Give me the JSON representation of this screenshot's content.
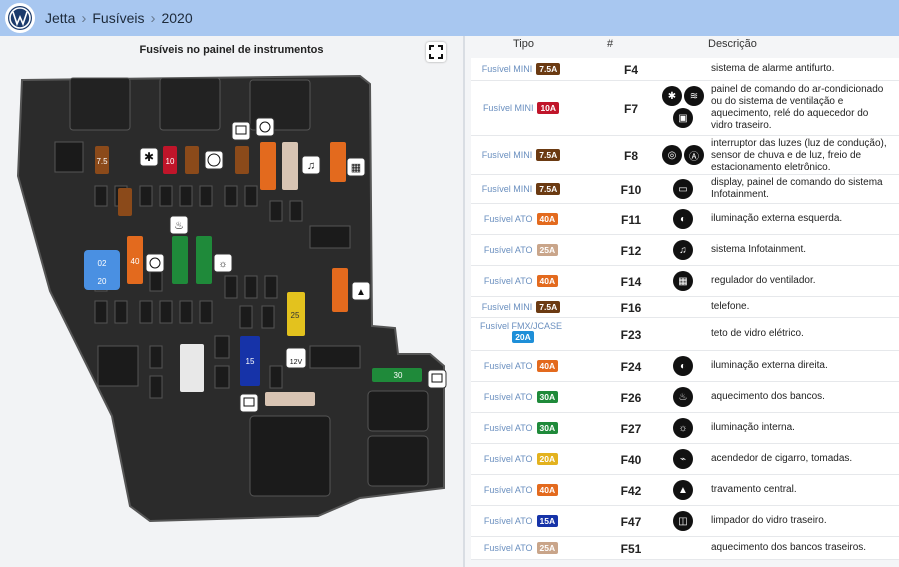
{
  "header": {
    "breadcrumbs": [
      "Jetta",
      "Fusíveis",
      "2020"
    ]
  },
  "left_panel": {
    "title": "Fusíveis no painel de instrumentos"
  },
  "table": {
    "columns": [
      "Tipo",
      "#",
      "Descrição"
    ],
    "rows": [
      {
        "type": "Fusível MINI",
        "amp": "7.5A",
        "color": "#6b3a12",
        "id": "F4",
        "icons": [],
        "desc": "sistema de alarme antifurto."
      },
      {
        "type": "Fusível MINI",
        "amp": "10A",
        "color": "#c0152a",
        "id": "F7",
        "icons": [
          "fan-icon",
          "heated-rear-window-icon",
          "ac-seat-icon"
        ],
        "desc": "painel de comando do ar-condicionado ou do sistema de ventilação e aquecimento, relé do aquecedor do vidro traseiro."
      },
      {
        "type": "Fusível MINI",
        "amp": "7.5A",
        "color": "#6b3a12",
        "id": "F8",
        "icons": [
          "rain-sensor-icon",
          "auto-light-icon"
        ],
        "desc": "interruptor das luzes (luz de condução), sensor de chuva e de luz, freio de estacionamento eletrônico."
      },
      {
        "type": "Fusível MINI",
        "amp": "7.5A",
        "color": "#6b3a12",
        "id": "F10",
        "icons": [
          "display-icon"
        ],
        "desc": "display, painel de comando do sistema Infotainment."
      },
      {
        "type": "Fusível ATO",
        "amp": "40A",
        "color": "#e36a1e",
        "id": "F11",
        "icons": [
          "headlight-icon"
        ],
        "desc": "iluminação externa esquerda."
      },
      {
        "type": "Fusível ATO",
        "amp": "25A",
        "color": "#c9a58a",
        "id": "F12",
        "icons": [
          "music-icon"
        ],
        "desc": "sistema Infotainment."
      },
      {
        "type": "Fusível ATO",
        "amp": "40A",
        "color": "#e36a1e",
        "id": "F14",
        "icons": [
          "fan-regulator-icon"
        ],
        "desc": "regulador do ventilador."
      },
      {
        "type": "Fusível MINI",
        "amp": "7.5A",
        "color": "#6b3a12",
        "id": "F16",
        "icons": [],
        "desc": "telefone."
      },
      {
        "type": "Fusível FMX/JCASE",
        "amp": "20A",
        "color": "#1e8fd8",
        "id": "F23",
        "icons": [],
        "desc": "teto de vidro elétrico."
      },
      {
        "type": "Fusível ATO",
        "amp": "40A",
        "color": "#e36a1e",
        "id": "F24",
        "icons": [
          "headlight-icon"
        ],
        "desc": "iluminação externa direita."
      },
      {
        "type": "Fusível ATO",
        "amp": "30A",
        "color": "#1f8a3a",
        "id": "F26",
        "icons": [
          "seat-heat-icon"
        ],
        "desc": "aquecimento dos bancos."
      },
      {
        "type": "Fusível ATO",
        "amp": "30A",
        "color": "#1f8a3a",
        "id": "F27",
        "icons": [
          "interior-light-icon"
        ],
        "desc": "iluminação interna."
      },
      {
        "type": "Fusível ATO",
        "amp": "20A",
        "color": "#e3b21e",
        "id": "F40",
        "icons": [
          "lighter-icon"
        ],
        "desc": "acendedor de cigarro, tomadas."
      },
      {
        "type": "Fusível ATO",
        "amp": "40A",
        "color": "#e36a1e",
        "id": "F42",
        "icons": [
          "lock-icon"
        ],
        "desc": "travamento central."
      },
      {
        "type": "Fusível ATO",
        "amp": "15A",
        "color": "#1633a8",
        "id": "F47",
        "icons": [
          "rear-wiper-icon"
        ],
        "desc": "limpador do vidro traseiro."
      },
      {
        "type": "Fusível ATO",
        "amp": "25A",
        "color": "#c9a58a",
        "id": "F51",
        "icons": [],
        "desc": "aquecimento dos bancos traseiros."
      }
    ]
  },
  "diagram_labels": {
    "f7_5a": "7.5",
    "f10": "10",
    "f_big_20": "20",
    "f_big_02": "02",
    "f_40": "40",
    "f_30": "30",
    "f_15": "15",
    "f_25": "25",
    "f_12v": "12V"
  }
}
